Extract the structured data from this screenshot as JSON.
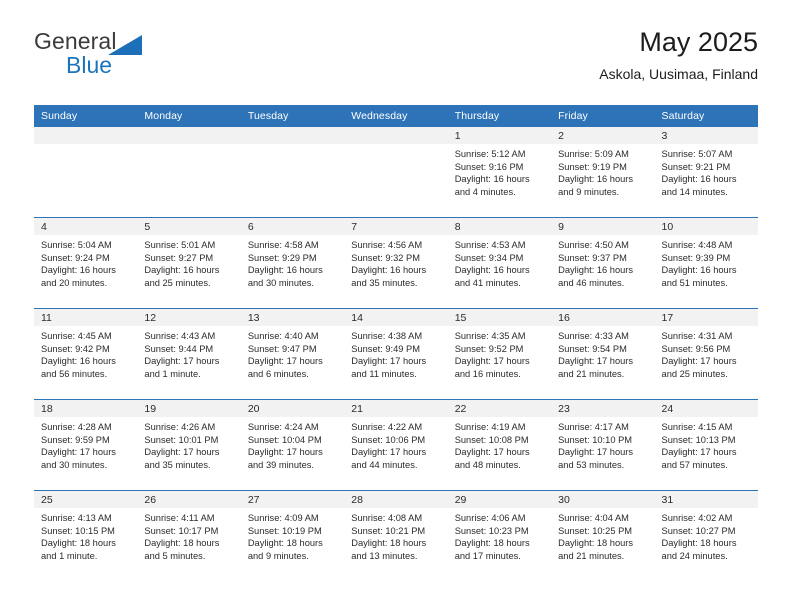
{
  "brand": {
    "name_top": "General",
    "name_bottom": "Blue",
    "triangle_color": "#1c6fb8",
    "blue_text_color": "#1c75bc"
  },
  "header": {
    "title": "May 2025",
    "subtitle": "Askola, Uusimaa, Finland"
  },
  "theme": {
    "header_bg": "#2e73b8",
    "header_text": "#ffffff",
    "daynum_band_bg": "#f2f2f2",
    "cell_bg": "#ffffff",
    "row_divider": "#2e73b8"
  },
  "weekday_headers": [
    "Sunday",
    "Monday",
    "Tuesday",
    "Wednesday",
    "Thursday",
    "Friday",
    "Saturday"
  ],
  "weeks": [
    [
      {
        "day": "",
        "empty": true
      },
      {
        "day": "",
        "empty": true
      },
      {
        "day": "",
        "empty": true
      },
      {
        "day": "",
        "empty": true
      },
      {
        "day": "1",
        "sunrise": "Sunrise: 5:12 AM",
        "sunset": "Sunset: 9:16 PM",
        "daylight": "Daylight: 16 hours and 4 minutes."
      },
      {
        "day": "2",
        "sunrise": "Sunrise: 5:09 AM",
        "sunset": "Sunset: 9:19 PM",
        "daylight": "Daylight: 16 hours and 9 minutes."
      },
      {
        "day": "3",
        "sunrise": "Sunrise: 5:07 AM",
        "sunset": "Sunset: 9:21 PM",
        "daylight": "Daylight: 16 hours and 14 minutes."
      }
    ],
    [
      {
        "day": "4",
        "sunrise": "Sunrise: 5:04 AM",
        "sunset": "Sunset: 9:24 PM",
        "daylight": "Daylight: 16 hours and 20 minutes."
      },
      {
        "day": "5",
        "sunrise": "Sunrise: 5:01 AM",
        "sunset": "Sunset: 9:27 PM",
        "daylight": "Daylight: 16 hours and 25 minutes."
      },
      {
        "day": "6",
        "sunrise": "Sunrise: 4:58 AM",
        "sunset": "Sunset: 9:29 PM",
        "daylight": "Daylight: 16 hours and 30 minutes."
      },
      {
        "day": "7",
        "sunrise": "Sunrise: 4:56 AM",
        "sunset": "Sunset: 9:32 PM",
        "daylight": "Daylight: 16 hours and 35 minutes."
      },
      {
        "day": "8",
        "sunrise": "Sunrise: 4:53 AM",
        "sunset": "Sunset: 9:34 PM",
        "daylight": "Daylight: 16 hours and 41 minutes."
      },
      {
        "day": "9",
        "sunrise": "Sunrise: 4:50 AM",
        "sunset": "Sunset: 9:37 PM",
        "daylight": "Daylight: 16 hours and 46 minutes."
      },
      {
        "day": "10",
        "sunrise": "Sunrise: 4:48 AM",
        "sunset": "Sunset: 9:39 PM",
        "daylight": "Daylight: 16 hours and 51 minutes."
      }
    ],
    [
      {
        "day": "11",
        "sunrise": "Sunrise: 4:45 AM",
        "sunset": "Sunset: 9:42 PM",
        "daylight": "Daylight: 16 hours and 56 minutes."
      },
      {
        "day": "12",
        "sunrise": "Sunrise: 4:43 AM",
        "sunset": "Sunset: 9:44 PM",
        "daylight": "Daylight: 17 hours and 1 minute."
      },
      {
        "day": "13",
        "sunrise": "Sunrise: 4:40 AM",
        "sunset": "Sunset: 9:47 PM",
        "daylight": "Daylight: 17 hours and 6 minutes."
      },
      {
        "day": "14",
        "sunrise": "Sunrise: 4:38 AM",
        "sunset": "Sunset: 9:49 PM",
        "daylight": "Daylight: 17 hours and 11 minutes."
      },
      {
        "day": "15",
        "sunrise": "Sunrise: 4:35 AM",
        "sunset": "Sunset: 9:52 PM",
        "daylight": "Daylight: 17 hours and 16 minutes."
      },
      {
        "day": "16",
        "sunrise": "Sunrise: 4:33 AM",
        "sunset": "Sunset: 9:54 PM",
        "daylight": "Daylight: 17 hours and 21 minutes."
      },
      {
        "day": "17",
        "sunrise": "Sunrise: 4:31 AM",
        "sunset": "Sunset: 9:56 PM",
        "daylight": "Daylight: 17 hours and 25 minutes."
      }
    ],
    [
      {
        "day": "18",
        "sunrise": "Sunrise: 4:28 AM",
        "sunset": "Sunset: 9:59 PM",
        "daylight": "Daylight: 17 hours and 30 minutes."
      },
      {
        "day": "19",
        "sunrise": "Sunrise: 4:26 AM",
        "sunset": "Sunset: 10:01 PM",
        "daylight": "Daylight: 17 hours and 35 minutes."
      },
      {
        "day": "20",
        "sunrise": "Sunrise: 4:24 AM",
        "sunset": "Sunset: 10:04 PM",
        "daylight": "Daylight: 17 hours and 39 minutes."
      },
      {
        "day": "21",
        "sunrise": "Sunrise: 4:22 AM",
        "sunset": "Sunset: 10:06 PM",
        "daylight": "Daylight: 17 hours and 44 minutes."
      },
      {
        "day": "22",
        "sunrise": "Sunrise: 4:19 AM",
        "sunset": "Sunset: 10:08 PM",
        "daylight": "Daylight: 17 hours and 48 minutes."
      },
      {
        "day": "23",
        "sunrise": "Sunrise: 4:17 AM",
        "sunset": "Sunset: 10:10 PM",
        "daylight": "Daylight: 17 hours and 53 minutes."
      },
      {
        "day": "24",
        "sunrise": "Sunrise: 4:15 AM",
        "sunset": "Sunset: 10:13 PM",
        "daylight": "Daylight: 17 hours and 57 minutes."
      }
    ],
    [
      {
        "day": "25",
        "sunrise": "Sunrise: 4:13 AM",
        "sunset": "Sunset: 10:15 PM",
        "daylight": "Daylight: 18 hours and 1 minute."
      },
      {
        "day": "26",
        "sunrise": "Sunrise: 4:11 AM",
        "sunset": "Sunset: 10:17 PM",
        "daylight": "Daylight: 18 hours and 5 minutes."
      },
      {
        "day": "27",
        "sunrise": "Sunrise: 4:09 AM",
        "sunset": "Sunset: 10:19 PM",
        "daylight": "Daylight: 18 hours and 9 minutes."
      },
      {
        "day": "28",
        "sunrise": "Sunrise: 4:08 AM",
        "sunset": "Sunset: 10:21 PM",
        "daylight": "Daylight: 18 hours and 13 minutes."
      },
      {
        "day": "29",
        "sunrise": "Sunrise: 4:06 AM",
        "sunset": "Sunset: 10:23 PM",
        "daylight": "Daylight: 18 hours and 17 minutes."
      },
      {
        "day": "30",
        "sunrise": "Sunrise: 4:04 AM",
        "sunset": "Sunset: 10:25 PM",
        "daylight": "Daylight: 18 hours and 21 minutes."
      },
      {
        "day": "31",
        "sunrise": "Sunrise: 4:02 AM",
        "sunset": "Sunset: 10:27 PM",
        "daylight": "Daylight: 18 hours and 24 minutes."
      }
    ]
  ]
}
